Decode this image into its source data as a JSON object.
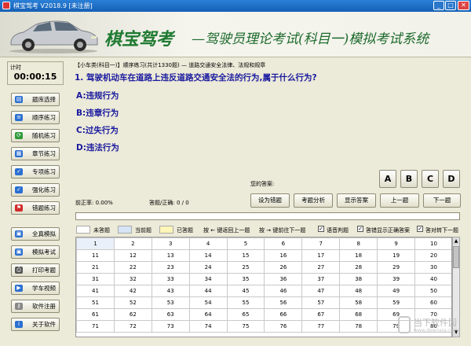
{
  "window": {
    "title": "棋宝驾考 V2018.9 [未注册]",
    "min_label": "_",
    "max_label": "□",
    "close_label": "✕"
  },
  "banner": {
    "brand": "棋宝驾考",
    "subtitle": "—驾驶员理论考试(科目一)模拟考试系统"
  },
  "timer": {
    "label": "计时",
    "value": "00:00:15"
  },
  "sidebar": {
    "top_items": [
      {
        "label": "题库选择",
        "icon": "book-icon",
        "color": "#2b6fd1"
      },
      {
        "label": "顺序练习",
        "icon": "list-icon",
        "color": "#2b6fd1"
      },
      {
        "label": "随机练习",
        "icon": "refresh-icon",
        "color": "#2f9a3a"
      },
      {
        "label": "章节练习",
        "icon": "chapter-icon",
        "color": "#2b6fd1"
      },
      {
        "label": "专项练习",
        "icon": "check-icon",
        "color": "#2b6fd1"
      },
      {
        "label": "强化练习",
        "icon": "check-icon",
        "color": "#2b6fd1"
      },
      {
        "label": "错题练习",
        "icon": "flag-icon",
        "color": "#d02b2b"
      }
    ],
    "bottom_items": [
      {
        "label": "全真模拟",
        "icon": "exam-icon",
        "color": "#2b6fd1"
      },
      {
        "label": "模拟考试",
        "icon": "exam-icon",
        "color": "#2b6fd1"
      },
      {
        "label": "打印考题",
        "icon": "print-icon",
        "color": "#555555"
      },
      {
        "label": "学车视频",
        "icon": "video-icon",
        "color": "#2b6fd1"
      },
      {
        "label": "软件注册",
        "icon": "key-icon",
        "color": "#888888"
      },
      {
        "label": "关于软件",
        "icon": "info-icon",
        "color": "#2b6fd1"
      }
    ]
  },
  "breadcrumb": "【小车类(科目一)】顺序练习(共计1330题) — 道路交通安全法律、法规和规章",
  "question": {
    "text": "1. 驾驶机动车在道路上违反道路交通安全法的行为,属于什么行为?",
    "options": [
      "A:违规行为",
      "B:违章行为",
      "C:过失行为",
      "D:违法行为"
    ]
  },
  "answer": {
    "label": "您的答案:",
    "buttons": [
      "A",
      "B",
      "C",
      "D"
    ]
  },
  "stats": {
    "accuracy": "前正率: 0.00%",
    "answered": "答题/正确: 0 / 0"
  },
  "actions": [
    "设为错题",
    "考题分析",
    "显示答案",
    "上一题",
    "下一题"
  ],
  "progress": 0,
  "legend": {
    "unanswered": "未答题",
    "current": "当前题",
    "answered": "已答题",
    "prev_hint": "按 ← 键返回上一题",
    "next_hint": "按 → 键前往下一题",
    "opt_voice": "语音判题",
    "opt_show_correct": "答错显示正确答案",
    "opt_auto_next": "答对转下一题",
    "colors": {
      "unanswered": "#ffffff",
      "current": "#d6e4f5",
      "answered": "#fff5b8"
    }
  },
  "grid": {
    "rows": [
      [
        "1",
        "2",
        "3",
        "4",
        "5",
        "6",
        "7",
        "8",
        "9",
        "10"
      ],
      [
        "11",
        "12",
        "13",
        "14",
        "15",
        "16",
        "17",
        "18",
        "19",
        "20"
      ],
      [
        "21",
        "22",
        "23",
        "24",
        "25",
        "26",
        "27",
        "28",
        "29",
        "30"
      ],
      [
        "31",
        "32",
        "33",
        "34",
        "35",
        "36",
        "37",
        "38",
        "39",
        "40"
      ],
      [
        "41",
        "42",
        "43",
        "44",
        "45",
        "46",
        "47",
        "48",
        "49",
        "50"
      ],
      [
        "51",
        "52",
        "53",
        "54",
        "55",
        "56",
        "57",
        "58",
        "59",
        "60"
      ],
      [
        "61",
        "62",
        "63",
        "64",
        "65",
        "66",
        "67",
        "68",
        "69",
        "70"
      ],
      [
        "71",
        "72",
        "73",
        "74",
        "75",
        "76",
        "77",
        "78",
        "79",
        "80"
      ]
    ]
  },
  "watermark": {
    "text": "当下软件园",
    "url": "www.downxia.com"
  }
}
